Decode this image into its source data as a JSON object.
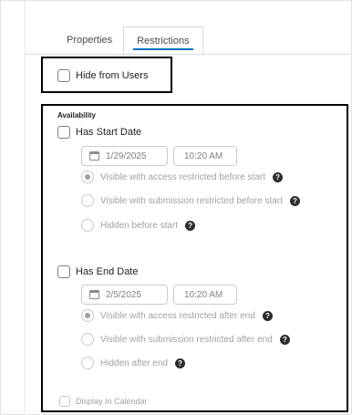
{
  "tabs": [
    {
      "label": "Properties",
      "active": false
    },
    {
      "label": "Restrictions",
      "active": true
    }
  ],
  "hide_from_users": {
    "label": "Hide from Users",
    "checked": false
  },
  "availability": {
    "heading": "Availability",
    "start": {
      "label": "Has Start Date",
      "checked": false,
      "date": "1/29/2025",
      "time": "10:20 AM",
      "options": [
        {
          "label": "Visible with access restricted before start",
          "selected": true
        },
        {
          "label": "Visible with submission restricted before start",
          "selected": false
        },
        {
          "label": "Hidden before start",
          "selected": false
        }
      ]
    },
    "end": {
      "label": "Has End Date",
      "checked": false,
      "date": "2/5/2025",
      "time": "10:20 AM",
      "options": [
        {
          "label": "Visible with access restricted after end",
          "selected": true
        },
        {
          "label": "Visible with submission restricted after end",
          "selected": false
        },
        {
          "label": "Hidden after end",
          "selected": false
        }
      ]
    },
    "display_in_calendar": {
      "label": "Display In Calendar",
      "checked": false
    }
  },
  "help_icon": "help-circle-icon",
  "colors": {
    "accent": "#006fbf",
    "highlight_box": "#000000",
    "disabled_text": "#9ea2a5"
  }
}
